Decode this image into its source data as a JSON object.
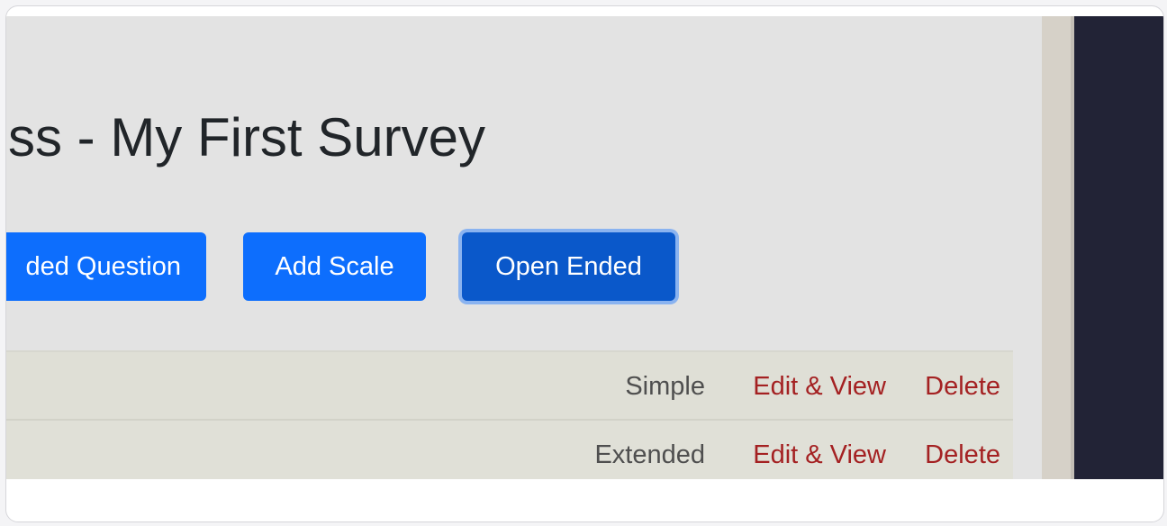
{
  "page": {
    "title": "ss - My First Survey"
  },
  "toolbar": {
    "closed_ended_label": "ded Question",
    "add_scale_label": "Add Scale",
    "open_ended_label": "Open Ended"
  },
  "questions": [
    {
      "type": "Simple",
      "edit_label": "Edit & View",
      "delete_label": "Delete"
    },
    {
      "type": "Extended",
      "edit_label": "Edit & View",
      "delete_label": "Delete"
    }
  ],
  "colors": {
    "primary_button": "#0d6efd",
    "active_button": "#0a58ca",
    "link_red": "#a42122",
    "page_background": "#e3e3e3",
    "side_panel": "#222336"
  }
}
